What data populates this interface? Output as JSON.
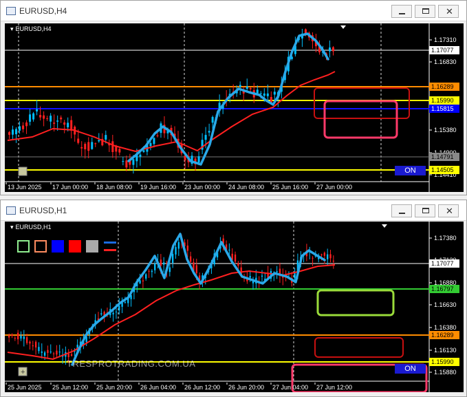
{
  "top_window": {
    "title": "EURUSD,H4",
    "symbol_label": "EURUSD,H4",
    "price_scale": [
      "1.17310",
      "1.16830",
      "1.15870",
      "1.15380",
      "1.14900",
      "1.14410"
    ],
    "price_labels": [
      {
        "text": "1.17077",
        "bg": "#ffffff",
        "fg": "#000000"
      },
      {
        "text": "1.16289",
        "bg": "#ff8c00",
        "fg": "#000000"
      },
      {
        "text": "1.15990",
        "bg": "#ffff00",
        "fg": "#000000"
      },
      {
        "text": "1.15815",
        "bg": "#0000ff",
        "fg": "#ffffff"
      },
      {
        "text": "1.14791",
        "bg": "#888888",
        "fg": "#000000"
      },
      {
        "text": "1.14505",
        "bg": "#ffff00",
        "fg": "#000000"
      }
    ],
    "time_labels": [
      "13 Jun 2025",
      "17 Jun 00:00",
      "18 Jun 08:00",
      "19 Jun 16:00",
      "23 Jun 00:00",
      "24 Jun 08:00",
      "25 Jun 16:00",
      "27 Jun 00:00"
    ],
    "on_label": "ON"
  },
  "bottom_window": {
    "title": "EURUSD,H1",
    "symbol_label": "EURUSD,H1",
    "price_scale": [
      "1.17380",
      "1.17130",
      "1.16880",
      "1.16630",
      "1.16380",
      "1.16130",
      "1.15880"
    ],
    "price_labels": [
      {
        "text": "1.17077",
        "bg": "#ffffff",
        "fg": "#000000"
      },
      {
        "text": "1.16797",
        "bg": "#33cc33",
        "fg": "#000000"
      },
      {
        "text": "1.16289",
        "bg": "#ff8c00",
        "fg": "#000000"
      },
      {
        "text": "1.15990",
        "bg": "#ffff00",
        "fg": "#000000"
      }
    ],
    "time_labels": [
      "25 Jun 2025",
      "25 Jun 12:00",
      "25 Jun 20:00",
      "26 Jun 04:00",
      "26 Jun 12:00",
      "26 Jun 20:00",
      "27 Jun 04:00",
      "27 Jun 12:00"
    ],
    "watermark": "TRESPROTRADING.COM.UA",
    "on_label": "ON",
    "toolbox_colors": [
      "#90ee90",
      "#ff8c60",
      "#0000ff",
      "#ff0000",
      "#aaaaaa"
    ]
  },
  "colors": {
    "candle_up": "#00bfff",
    "candle_down": "#ff2020",
    "ma_line": "#ff2020",
    "hand_line": "#2aa8e8",
    "orange_level": "#ff8c00",
    "yellow_level": "#ffff00",
    "blue_level": "#0000ff",
    "green_level": "#33cc33",
    "pink_box": "#ff3a6a",
    "dark_red_box": "#c81010",
    "lime_box": "#9adb3a"
  }
}
